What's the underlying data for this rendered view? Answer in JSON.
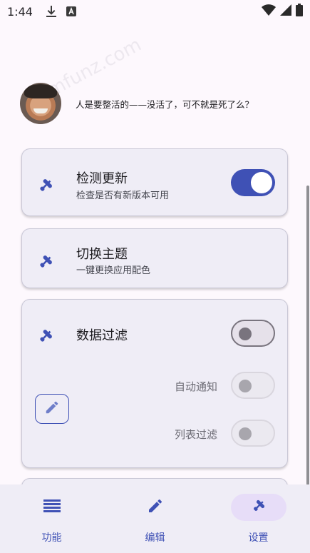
{
  "status_bar": {
    "time": "1:44"
  },
  "watermark": "mfunz.com",
  "profile": {
    "motto": "人是要整活的——没活了，可不就是死了么？"
  },
  "cards": {
    "check_update": {
      "title": "检测更新",
      "subtitle": "检查是否有新版本可用",
      "toggle_on": true
    },
    "switch_theme": {
      "title": "切换主题",
      "subtitle": "一键更换应用配色"
    },
    "data_filter": {
      "title": "数据过滤",
      "toggle_on": false,
      "options": [
        {
          "label": "自动通知",
          "enabled": false
        },
        {
          "label": "列表过滤",
          "enabled": false
        }
      ]
    }
  },
  "bottom_nav": {
    "items": [
      {
        "label": "功能",
        "icon": "list-icon",
        "active": false
      },
      {
        "label": "编辑",
        "icon": "pencil-icon",
        "active": false
      },
      {
        "label": "设置",
        "icon": "plugin-icon",
        "active": true
      }
    ]
  },
  "colors": {
    "accent": "#3f51b5",
    "card_bg": "#efedf6",
    "page_bg": "#fdf8fd",
    "nav_active_pill": "#e7ddf8"
  }
}
